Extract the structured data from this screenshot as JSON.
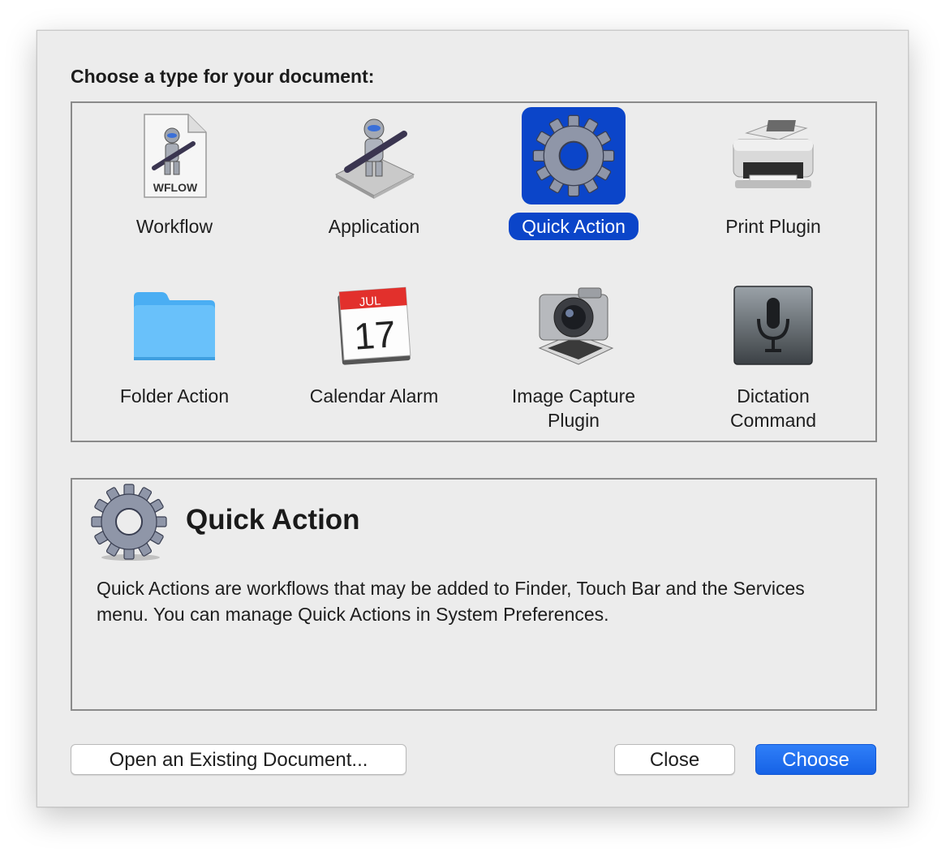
{
  "dialog": {
    "prompt": "Choose a type for your document:"
  },
  "types": [
    {
      "label": "Workflow",
      "icon": "workflow-document-icon",
      "badge": "WFLOW",
      "selected": false
    },
    {
      "label": "Application",
      "icon": "automator-robot-icon",
      "selected": false
    },
    {
      "label": "Quick Action",
      "icon": "gear-icon",
      "selected": true
    },
    {
      "label": "Print Plugin",
      "icon": "printer-icon",
      "selected": false
    },
    {
      "label": "Folder Action",
      "icon": "folder-icon",
      "selected": false
    },
    {
      "label": "Calendar Alarm",
      "icon": "calendar-icon",
      "month": "JUL",
      "day": "17",
      "selected": false
    },
    {
      "label": "Image Capture Plugin",
      "icon": "camera-icon",
      "selected": false
    },
    {
      "label": "Dictation Command",
      "icon": "microphone-icon",
      "selected": false
    }
  ],
  "description": {
    "title": "Quick Action",
    "icon": "gear-icon",
    "text": "Quick Actions are workflows that may be added to Finder, Touch Bar and the Services menu. You can manage Quick Actions in System Preferences."
  },
  "buttons": {
    "open": "Open an Existing Document...",
    "close": "Close",
    "choose": "Choose"
  },
  "colors": {
    "selection": "#0b45c9",
    "primary_button": "#1a6cf0",
    "dialog_bg": "#ececec"
  }
}
